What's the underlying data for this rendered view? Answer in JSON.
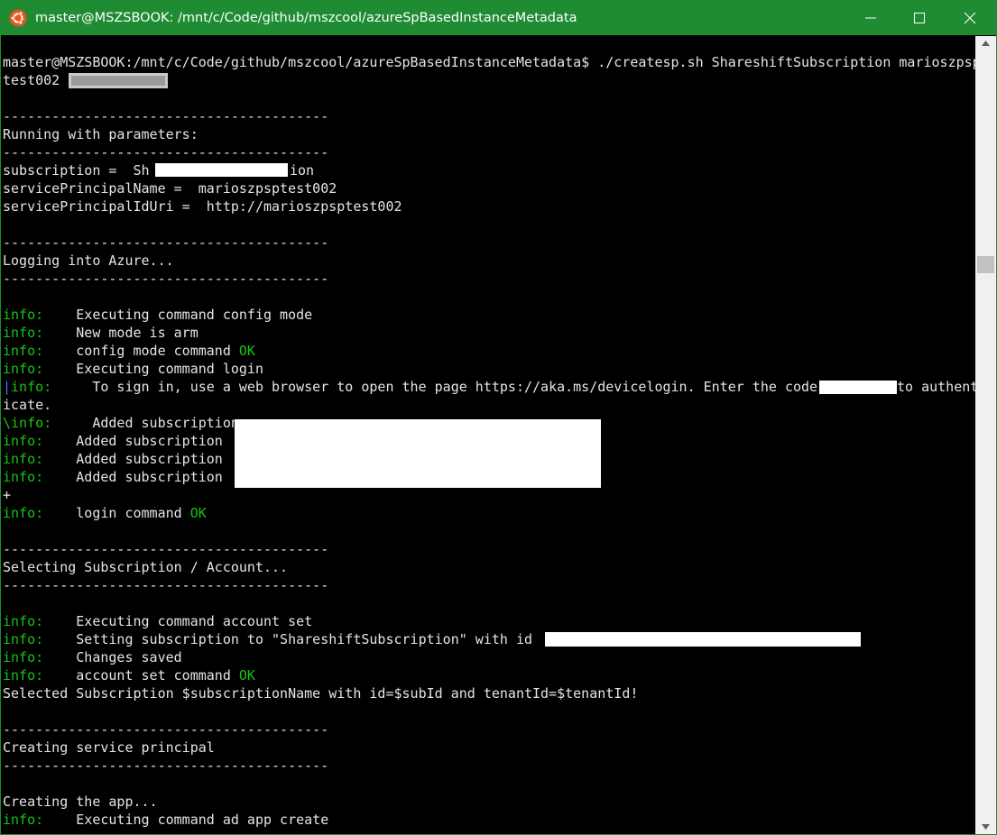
{
  "window": {
    "title": "master@MSZSBOOK: /mnt/c/Code/github/mszcool/azureSpBasedInstanceMetadata",
    "controls": {
      "minimize": "minimize-icon",
      "maximize": "maximize-icon",
      "close": "close-icon"
    },
    "app_icon": "ubuntu-icon",
    "accent_color": "#1f8b33"
  },
  "terminal": {
    "prompt_line_1": "master@MSZSBOOK:/mnt/c/Code/github/mszcool/azureSpBasedInstanceMetadata$ ./createsp.sh ShareshiftSubscription marioszpsp",
    "prompt_line_2": "test002 ",
    "sep1": "----------------------------------------",
    "running": "Running with parameters:",
    "sep2": "----------------------------------------",
    "param_subscription_a": "subscription =  Sh",
    "param_subscription_b": "ion",
    "param_sp_name": "servicePrincipalName =  marioszpsptest002",
    "param_sp_uri": "servicePrincipalIdUri =  http://marioszpsptest002",
    "sep3": "----------------------------------------",
    "logging": "Logging into Azure...",
    "sep4": "----------------------------------------",
    "info_label": "info:",
    "msg_exec_config": "    Executing command config mode",
    "msg_new_mode": "    New mode is arm",
    "msg_config_ok": "    config mode command ",
    "ok": "OK",
    "msg_exec_login": "    Executing command login",
    "spinner_1": "|",
    "msg_signin": "     To sign in, use a web browser to open the page https://aka.ms/devicelogin. Enter the code ",
    "msg_signin_tail": "to authent",
    "msg_signin_wrap": "icate.",
    "spinner_2": "\\",
    "msg_added_sub": "    Added subscription",
    "msg_added_sub_indent": "     Added subscription",
    "spinner_3": "+",
    "msg_login_ok": "    login command ",
    "sep5": "----------------------------------------",
    "selecting": "Selecting Subscription / Account...",
    "sep6": "----------------------------------------",
    "msg_exec_account": "    Executing command account set",
    "msg_setting_sub": "    Setting subscription to \"ShareshiftSubscription\" with id ",
    "msg_changes_saved": "    Changes saved",
    "msg_account_ok": "    account set command ",
    "selected": "Selected Subscription $subscriptionName with id=$subId and tenantId=$tenantId!",
    "sep7": "----------------------------------------",
    "creating_sp": "Creating service principal",
    "sep8": "----------------------------------------",
    "creating_app": "Creating the app...",
    "msg_exec_ad": "    Executing command ad app create"
  },
  "scrollbar": {
    "up": "scroll-up-icon",
    "down": "scroll-down-icon"
  }
}
